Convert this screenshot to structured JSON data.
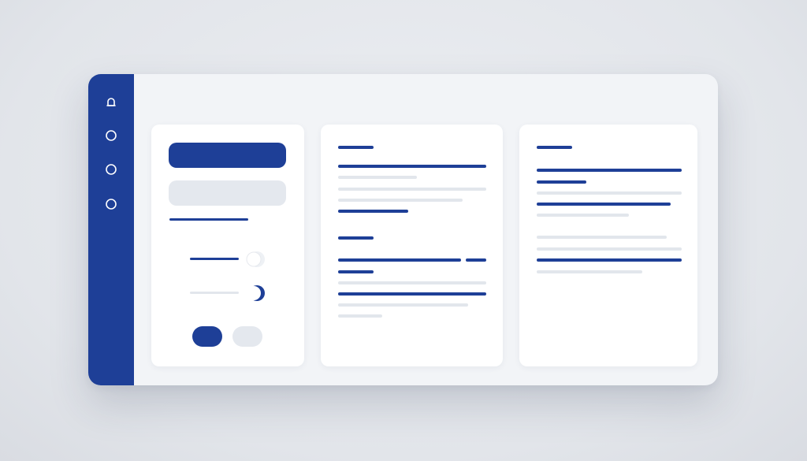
{
  "app": {
    "title": ""
  },
  "sidebar": {
    "items": [
      {
        "icon": "bell-icon"
      },
      {
        "icon": "circle-icon"
      },
      {
        "icon": "circle-icon"
      },
      {
        "icon": "circle-icon"
      }
    ]
  },
  "settings_panel": {
    "primary_button_label": "",
    "input_value": "",
    "toggles": [
      {
        "state": "off"
      },
      {
        "state": "on"
      }
    ],
    "action_buttons": [
      {
        "style": "primary",
        "label": ""
      },
      {
        "style": "secondary",
        "label": ""
      }
    ]
  },
  "document_panels": [
    {
      "title": "",
      "body": ""
    },
    {
      "title": "",
      "body": ""
    }
  ],
  "colors": {
    "accent": "#1e3f97",
    "placeholder": "#e2e6ec",
    "panel": "#ffffff",
    "window": "#f2f4f7",
    "background": "#e2e5ea"
  }
}
